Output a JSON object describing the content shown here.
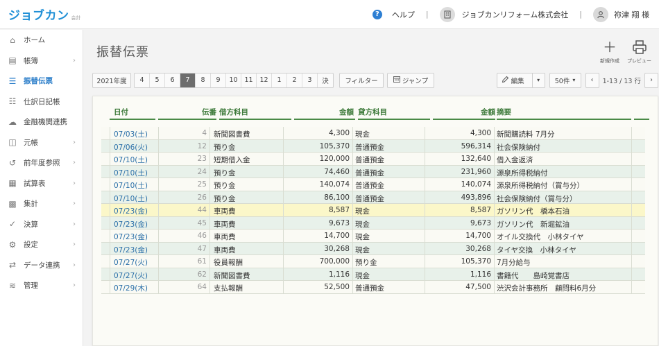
{
  "header": {
    "logo_main": "ジョブカン",
    "logo_sub": "会計",
    "help_label": "ヘルプ",
    "company_label": "ジョブカンリフォーム株式会社",
    "user_label": "祢津 翔 様",
    "separator": "|"
  },
  "sidebar": {
    "items": [
      {
        "label": "ホーム",
        "icon": "home-icon",
        "glyph": "⌂",
        "chevron": false,
        "active": false
      },
      {
        "label": "帳簿",
        "icon": "book-icon",
        "glyph": "▤",
        "chevron": true,
        "active": false
      },
      {
        "label": "振替伝票",
        "icon": "document-icon",
        "glyph": "☰",
        "chevron": false,
        "active": true
      },
      {
        "label": "仕訳日記帳",
        "icon": "list-icon",
        "glyph": "☷",
        "chevron": false,
        "active": false
      },
      {
        "label": "金融機関連携",
        "icon": "cloud-icon",
        "glyph": "☁",
        "chevron": false,
        "active": false
      },
      {
        "label": "元帳",
        "icon": "ledger-icon",
        "glyph": "◫",
        "chevron": true,
        "active": false
      },
      {
        "label": "前年度参照",
        "icon": "history-icon",
        "glyph": "↺",
        "chevron": true,
        "active": false
      },
      {
        "label": "試算表",
        "icon": "report-icon",
        "glyph": "▦",
        "chevron": true,
        "active": false
      },
      {
        "label": "集計",
        "icon": "calculator-icon",
        "glyph": "▩",
        "chevron": true,
        "active": false
      },
      {
        "label": "決算",
        "icon": "check-icon",
        "glyph": "✓",
        "chevron": true,
        "active": false
      },
      {
        "label": "設定",
        "icon": "gear-icon",
        "glyph": "⚙",
        "chevron": true,
        "active": false
      },
      {
        "label": "データ連携",
        "icon": "sync-icon",
        "glyph": "⇄",
        "chevron": true,
        "active": false
      },
      {
        "label": "管理",
        "icon": "layers-icon",
        "glyph": "≋",
        "chevron": true,
        "active": false
      }
    ]
  },
  "main": {
    "title": "振替伝票",
    "new_label": "新規作成",
    "preview_label": "プレビュー"
  },
  "toolbar": {
    "fiscal_year": "2021年度",
    "months": [
      "4",
      "5",
      "6",
      "7",
      "8",
      "9",
      "10",
      "11",
      "12",
      "1",
      "2",
      "3",
      "決"
    ],
    "active_month": "7",
    "filter_label": "フィルター",
    "jump_label": "ジャンプ",
    "edit_label": "編集",
    "per_page": "50件",
    "range_label": "1-13 / 13 行"
  },
  "table": {
    "headers": {
      "date": "日付",
      "no": "伝番",
      "debit_account": "借方科目",
      "debit_amount": "金額",
      "credit_account": "貸方科目",
      "credit_amount": "金額",
      "memo": "摘要"
    },
    "rows": [
      {
        "date": "07/03(土)",
        "no": "4",
        "debit_account": "新聞図書費",
        "debit_amount": "4,300",
        "credit_account": "現金",
        "credit_amount": "4,300",
        "memo": "新聞購読料 7月分",
        "shade": "odd"
      },
      {
        "date": "07/06(火)",
        "no": "12",
        "debit_account": "預り金",
        "debit_amount": "105,370",
        "credit_account": "普通預金",
        "credit_amount": "596,314",
        "memo": "社会保険納付",
        "shade": "even"
      },
      {
        "date": "07/10(土)",
        "no": "23",
        "debit_account": "短期借入金",
        "debit_amount": "120,000",
        "credit_account": "普通預金",
        "credit_amount": "132,640",
        "memo": "借入金返済",
        "shade": "odd"
      },
      {
        "date": "07/10(土)",
        "no": "24",
        "debit_account": "預り金",
        "debit_amount": "74,460",
        "credit_account": "普通預金",
        "credit_amount": "231,960",
        "memo": "源泉所得税納付",
        "shade": "even"
      },
      {
        "date": "07/10(土)",
        "no": "25",
        "debit_account": "預り金",
        "debit_amount": "140,074",
        "credit_account": "普通預金",
        "credit_amount": "140,074",
        "memo": "源泉所得税納付（賞与分）",
        "shade": "odd"
      },
      {
        "date": "07/10(土)",
        "no": "26",
        "debit_account": "預り金",
        "debit_amount": "86,100",
        "credit_account": "普通預金",
        "credit_amount": "493,896",
        "memo": "社会保険納付（賞与分）",
        "shade": "even"
      },
      {
        "date": "07/23(金)",
        "no": "44",
        "debit_account": "車両費",
        "debit_amount": "8,587",
        "credit_account": "現金",
        "credit_amount": "8,587",
        "memo": "ガソリン代　橋本石油",
        "shade": "hl"
      },
      {
        "date": "07/23(金)",
        "no": "45",
        "debit_account": "車両費",
        "debit_amount": "9,673",
        "credit_account": "現金",
        "credit_amount": "9,673",
        "memo": "ガソリン代　新堀鉱油",
        "shade": "even"
      },
      {
        "date": "07/23(金)",
        "no": "46",
        "debit_account": "車両費",
        "debit_amount": "14,700",
        "credit_account": "現金",
        "credit_amount": "14,700",
        "memo": "オイル交換代　小林タイヤ",
        "shade": "odd"
      },
      {
        "date": "07/23(金)",
        "no": "47",
        "debit_account": "車両費",
        "debit_amount": "30,268",
        "credit_account": "現金",
        "credit_amount": "30,268",
        "memo": "タイヤ交換　小林タイヤ",
        "shade": "even"
      },
      {
        "date": "07/27(火)",
        "no": "61",
        "debit_account": "役員報酬",
        "debit_amount": "700,000",
        "credit_account": "預り金",
        "credit_amount": "105,370",
        "memo": "7月分給与",
        "shade": "odd"
      },
      {
        "date": "07/27(火)",
        "no": "62",
        "debit_account": "新聞図書費",
        "debit_amount": "1,116",
        "credit_account": "現金",
        "credit_amount": "1,116",
        "memo": "書籍代　　島崎覚書店",
        "shade": "even"
      },
      {
        "date": "07/29(木)",
        "no": "64",
        "debit_account": "支払報酬",
        "debit_amount": "52,500",
        "credit_account": "普通預金",
        "credit_amount": "47,500",
        "memo": "渋沢会計事務所　顧問料6月分",
        "shade": "odd"
      }
    ]
  },
  "colors": {
    "brand_blue": "#1f8fd6",
    "active_nav": "#2a7dc9",
    "header_green": "#3d7a3a",
    "row_green": "#e8f1ea",
    "row_highlight": "#fbf7c9",
    "active_month_bg": "#6d6d6d"
  }
}
